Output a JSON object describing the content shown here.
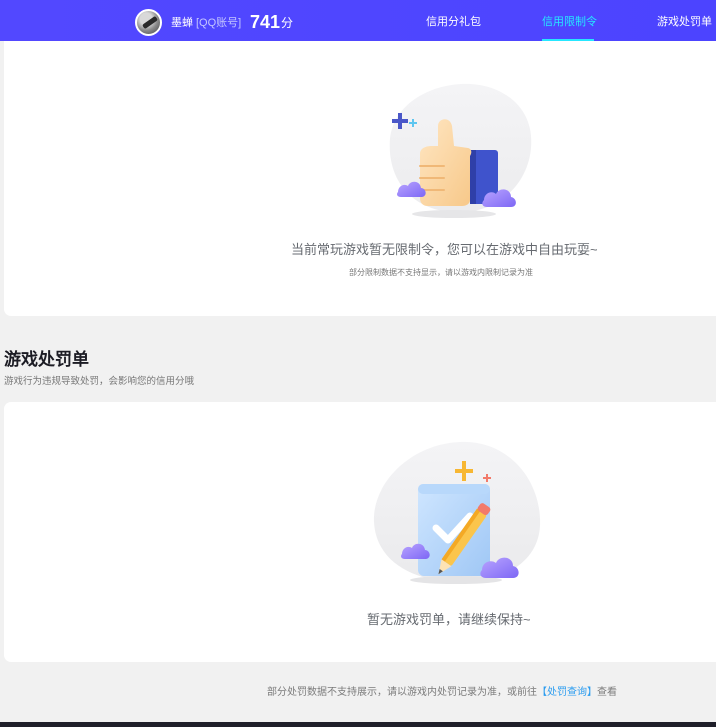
{
  "header": {
    "user_name": "墨蝉",
    "account_type": "[QQ账号]",
    "score_value": "741",
    "score_unit": "分",
    "tabs": [
      {
        "label": "信用分礼包",
        "active": false
      },
      {
        "label": "信用限制令",
        "active": true
      },
      {
        "label": "游戏处罚单",
        "active": false
      }
    ],
    "brand_color": "#4f4cff",
    "active_color": "#26e7ff"
  },
  "restrictions": {
    "empty_message": "当前常玩游戏暂无限制令，您可以在游戏中自由玩耍~",
    "note": "部分限制数据不支持显示，请以游戏内限制记录为准",
    "illustration_icon": "thumbs-up-icon"
  },
  "penalties": {
    "title": "游戏处罚单",
    "subtitle": "游戏行为违规导致处罚，会影响您的信用分哦",
    "empty_message": "暂无游戏罚单，请继续保持~",
    "illustration_icon": "checklist-pencil-icon"
  },
  "footer": {
    "note_prefix": "部分处罚数据不支持展示，请以游戏内处罚记录为准，或前往",
    "link_label": "【处罚查询】",
    "note_suffix": "查看",
    "link_color": "#2a9cf0"
  }
}
